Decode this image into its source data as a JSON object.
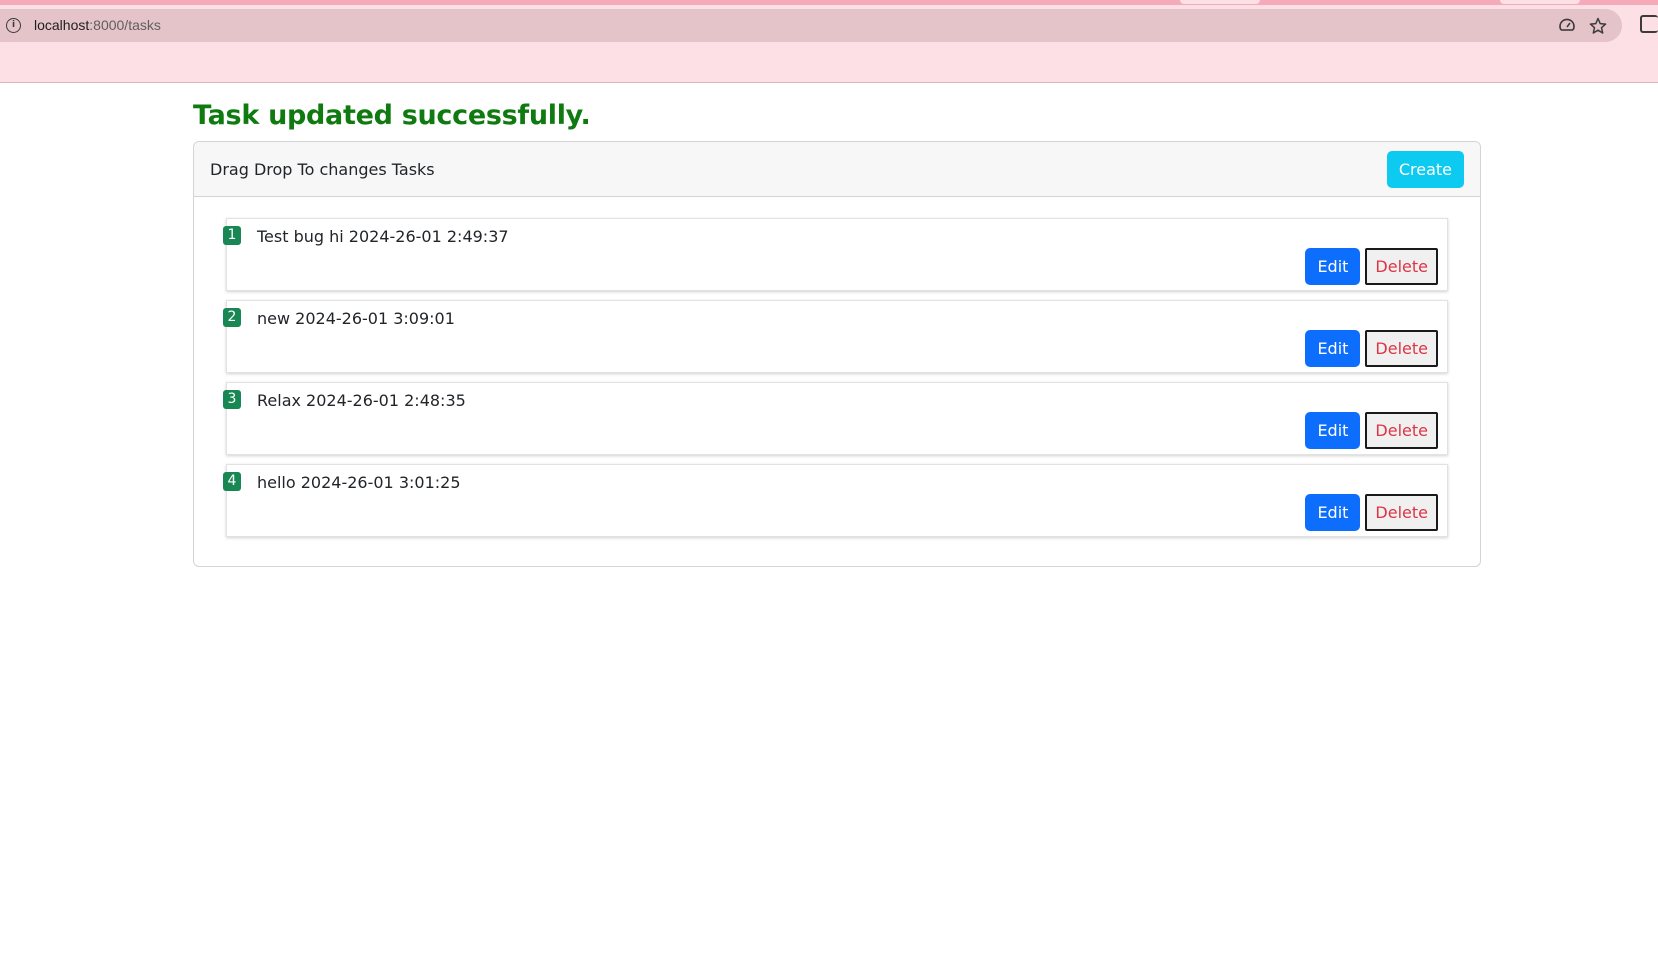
{
  "browser": {
    "url_host": "localhost",
    "url_rest": ":8000/tasks",
    "icons": [
      "info-icon",
      "cast-icon",
      "star-icon",
      "extensions-icon"
    ]
  },
  "flash_message": "Task updated successfully.",
  "card": {
    "header_title": "Drag Drop To changes Tasks",
    "create_label": "Create"
  },
  "tasks": [
    {
      "order": "1",
      "text": "Test bug hi 2024-26-01 2:49:37",
      "edit_label": "Edit",
      "delete_label": "Delete"
    },
    {
      "order": "2",
      "text": "new 2024-26-01 3:09:01",
      "edit_label": "Edit",
      "delete_label": "Delete"
    },
    {
      "order": "3",
      "text": "Relax 2024-26-01 2:48:35",
      "edit_label": "Edit",
      "delete_label": "Delete"
    },
    {
      "order": "4",
      "text": "hello 2024-26-01 3:01:25",
      "edit_label": "Edit",
      "delete_label": "Delete"
    }
  ],
  "colors": {
    "flash": "#0f7a0f",
    "create": "#0dcaf0",
    "edit": "#0d6efd",
    "delete_text": "#dc3545",
    "badge": "#198754",
    "chrome": "#fde0e6"
  }
}
